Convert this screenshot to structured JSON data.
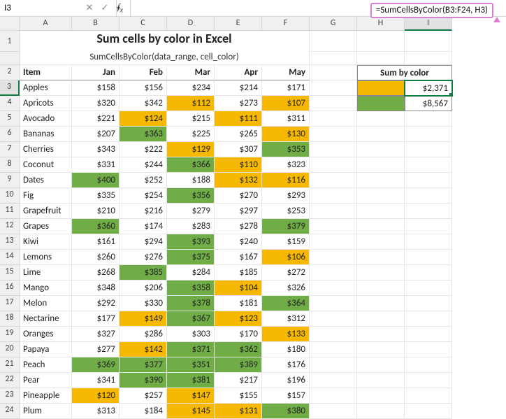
{
  "nameBox": "I3",
  "formulaBar": "",
  "callout": "=SumCellsByColor(B3:F24, H3)",
  "title": "Sum cells by color in Excel",
  "subtitle": "SumCellsByColor(data_range, cell_color)",
  "columns": [
    "A",
    "B",
    "C",
    "D",
    "E",
    "F",
    "G",
    "H",
    "I"
  ],
  "headers": {
    "item": "Item",
    "jan": "Jan",
    "feb": "Feb",
    "mar": "Mar",
    "apr": "Apr",
    "may": "May",
    "sum": "Sum by color"
  },
  "sum": {
    "yellow": "$2,371",
    "green": "$8,567"
  },
  "fruits": [
    {
      "n": "Apples",
      "v": [
        "$158",
        "$156",
        "$234",
        "$214",
        "$171"
      ],
      "f": [
        "",
        "",
        "",
        "",
        ""
      ]
    },
    {
      "n": "Apricots",
      "v": [
        "$320",
        "$342",
        "$112",
        "$273",
        "$107"
      ],
      "f": [
        "",
        "",
        "y",
        "",
        "y"
      ]
    },
    {
      "n": "Avocado",
      "v": [
        "$221",
        "$124",
        "$215",
        "$111",
        "$311"
      ],
      "f": [
        "",
        "y",
        "",
        "y",
        ""
      ]
    },
    {
      "n": "Bananas",
      "v": [
        "$207",
        "$363",
        "$225",
        "$265",
        "$130"
      ],
      "f": [
        "",
        "g",
        "",
        "",
        "y"
      ]
    },
    {
      "n": "Cherries",
      "v": [
        "$343",
        "$222",
        "$129",
        "$307",
        "$353"
      ],
      "f": [
        "",
        "",
        "y",
        "",
        "g"
      ]
    },
    {
      "n": "Coconut",
      "v": [
        "$331",
        "$244",
        "$366",
        "$110",
        "$323"
      ],
      "f": [
        "",
        "",
        "g",
        "y",
        ""
      ]
    },
    {
      "n": "Dates",
      "v": [
        "$400",
        "$252",
        "$188",
        "$132",
        "$116"
      ],
      "f": [
        "g",
        "",
        "",
        "y",
        "y"
      ]
    },
    {
      "n": "Fig",
      "v": [
        "$335",
        "$254",
        "$356",
        "$270",
        "$293"
      ],
      "f": [
        "",
        "",
        "g",
        "",
        ""
      ]
    },
    {
      "n": "Grapefruit",
      "v": [
        "$210",
        "$216",
        "$279",
        "$297",
        "$253"
      ],
      "f": [
        "",
        "",
        "",
        "",
        ""
      ]
    },
    {
      "n": "Grapes",
      "v": [
        "$360",
        "$174",
        "$283",
        "$278",
        "$379"
      ],
      "f": [
        "g",
        "",
        "",
        "",
        "g"
      ]
    },
    {
      "n": "Kiwi",
      "v": [
        "$161",
        "$294",
        "$393",
        "$240",
        "$159"
      ],
      "f": [
        "",
        "",
        "g",
        "",
        ""
      ]
    },
    {
      "n": "Lemons",
      "v": [
        "$260",
        "$276",
        "$375",
        "$167",
        "$106"
      ],
      "f": [
        "",
        "",
        "g",
        "",
        "y"
      ]
    },
    {
      "n": "Lime",
      "v": [
        "$268",
        "$385",
        "$284",
        "$185",
        "$272"
      ],
      "f": [
        "",
        "g",
        "",
        "",
        ""
      ]
    },
    {
      "n": "Mango",
      "v": [
        "$348",
        "$206",
        "$358",
        "$104",
        "$326"
      ],
      "f": [
        "",
        "",
        "g",
        "y",
        ""
      ]
    },
    {
      "n": "Melon",
      "v": [
        "$292",
        "$330",
        "$378",
        "$181",
        "$364"
      ],
      "f": [
        "",
        "",
        "g",
        "",
        "g"
      ]
    },
    {
      "n": "Nectarine",
      "v": [
        "$177",
        "$149",
        "$367",
        "$123",
        "$312"
      ],
      "f": [
        "",
        "y",
        "g",
        "y",
        ""
      ]
    },
    {
      "n": "Oranges",
      "v": [
        "$327",
        "$286",
        "$303",
        "$170",
        "$133"
      ],
      "f": [
        "",
        "",
        "",
        "",
        "y"
      ]
    },
    {
      "n": "Papaya",
      "v": [
        "$277",
        "$142",
        "$371",
        "$362",
        "$180"
      ],
      "f": [
        "",
        "y",
        "g",
        "g",
        ""
      ]
    },
    {
      "n": "Peach",
      "v": [
        "$369",
        "$377",
        "$351",
        "$389",
        "$176"
      ],
      "f": [
        "g",
        "g",
        "g",
        "g",
        ""
      ]
    },
    {
      "n": "Pear",
      "v": [
        "$341",
        "$390",
        "$381",
        "$217",
        "$196"
      ],
      "f": [
        "",
        "g",
        "g",
        "",
        ""
      ]
    },
    {
      "n": "Pineapple",
      "v": [
        "$120",
        "$257",
        "$147",
        "$155",
        "$157"
      ],
      "f": [
        "y",
        "",
        "y",
        "",
        ""
      ]
    },
    {
      "n": "Plum",
      "v": [
        "$313",
        "$184",
        "$145",
        "$131",
        "$380"
      ],
      "f": [
        "",
        "",
        "y",
        "y",
        "g"
      ]
    }
  ]
}
